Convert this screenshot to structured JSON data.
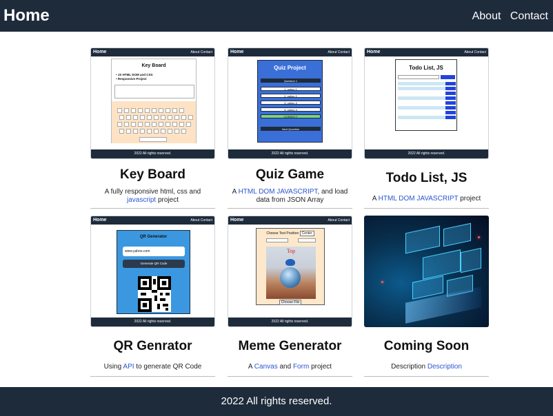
{
  "nav": {
    "brand": "Home",
    "links": [
      "About",
      "Contact"
    ]
  },
  "cards": [
    {
      "title": "Key Board",
      "desc": [
        {
          "text": "A fully responsive html, css and ",
          "link": false
        },
        {
          "text": "javascript",
          "link": true
        },
        {
          "text": " project",
          "link": false
        }
      ],
      "thumb": {
        "nav_brand": "Home",
        "nav_links": "About  Contact",
        "heading": "Key Board",
        "bullets": [
          "JS HTML DOM and CSS",
          "Responsive Project"
        ],
        "footer": "2022 All rights reserved."
      }
    },
    {
      "title": "Quiz Game",
      "desc": [
        {
          "text": "A ",
          "link": false
        },
        {
          "text": "HTML DOM JAVASCRIPT",
          "link": true
        },
        {
          "text": ", and load data from JSON Array",
          "link": false
        }
      ],
      "thumb": {
        "nav_brand": "Home",
        "nav_links": "About  Contact",
        "heading": "Quiz Project",
        "question": "Question 1",
        "options": [
          "1. option 1",
          "2. option 2",
          "3. option 3",
          "4. option 4",
          "CORRECT"
        ],
        "next": "Next Question",
        "footer": "2022 All rights reserved."
      }
    },
    {
      "title": "Todo List, JS",
      "desc": [
        {
          "text": "A ",
          "link": false
        },
        {
          "text": "HTML DOM JAVASCRIPT",
          "link": true
        },
        {
          "text": " project",
          "link": false
        }
      ],
      "thumb": {
        "nav_brand": "Home",
        "nav_links": "About  Contact",
        "heading": "Todo List, JS",
        "footer": "2022 All rights reserved."
      }
    },
    {
      "title": "QR Genrator",
      "desc": [
        {
          "text": "Using ",
          "link": false
        },
        {
          "text": "API",
          "link": true
        },
        {
          "text": " to generate QR Code",
          "link": false
        }
      ],
      "thumb": {
        "nav_brand": "Home",
        "nav_links": "About  Contact",
        "heading": "QR Generator",
        "input": "www.yahoo.com",
        "button": "Generate QR Code",
        "footer": "2022 All rights reserved."
      }
    },
    {
      "title": "Meme Generator",
      "desc": [
        {
          "text": "A ",
          "link": false
        },
        {
          "text": "Canvas",
          "link": true
        },
        {
          "text": " and ",
          "link": false
        },
        {
          "text": "Form",
          "link": true
        },
        {
          "text": " project",
          "link": false
        }
      ],
      "thumb": {
        "nav_brand": "Home",
        "nav_links": "About  Contact",
        "label": "Choose Text Position",
        "select": "Center",
        "caption": "Top",
        "file": "Choose File",
        "footer": "2022 All rights reserved."
      }
    },
    {
      "title": "Coming Soon",
      "desc": [
        {
          "text": "Description ",
          "link": false
        },
        {
          "text": "Description",
          "link": true
        }
      ]
    }
  ],
  "footer": {
    "text": "2022 All rights reserved."
  },
  "colors": {
    "nav_bg": "#1e2b3b",
    "link": "#2a55d0"
  }
}
